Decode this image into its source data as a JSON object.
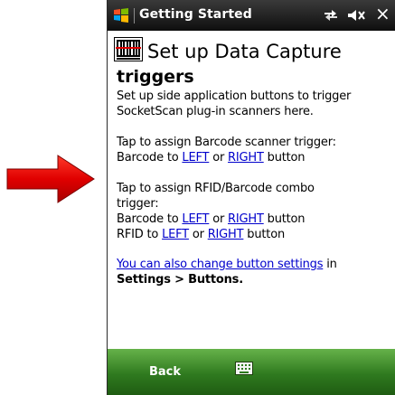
{
  "titlebar": {
    "title": "Getting Started",
    "close_label": "×",
    "icons": [
      "windows-start-icon",
      "connectivity-icon",
      "volume-icon",
      "close-icon"
    ]
  },
  "content": {
    "heading_line1": "Set up Data Capture",
    "heading_line2": "triggers",
    "intro_line1": "Set up side application buttons to trigger",
    "intro_line2": "SocketScan plug-in scanners here.",
    "barcode_assign_link": "Tap to assign Barcode scanner trigger:",
    "barcode_line": {
      "prefix": "Barcode to ",
      "left": "LEFT",
      "or": " or ",
      "right": "RIGHT",
      "suffix": " button"
    },
    "combo_assign_line1": "Tap to assign RFID/Barcode combo",
    "combo_assign_line2": "trigger:",
    "combo_barcode_line": {
      "prefix": "Barcode to ",
      "left": "LEFT",
      "or": " or ",
      "right": "RIGHT",
      "suffix": " button"
    },
    "combo_rfid_line": {
      "prefix": "RFID to ",
      "left": "LEFT",
      "or": " or ",
      "right": "RIGHT",
      "suffix": " button"
    },
    "settings_link": "You can also change button settings",
    "settings_in": " in",
    "settings_path": "Settings > Buttons."
  },
  "bottombar": {
    "back_label": "Back",
    "keyboard_icon": "keyboard-icon"
  },
  "annotation": {
    "arrow_color": "#e00000"
  },
  "colors": {
    "link": "#0000cc",
    "bottombar": "#3a8a26",
    "titlebar": "#1a1a1a"
  }
}
